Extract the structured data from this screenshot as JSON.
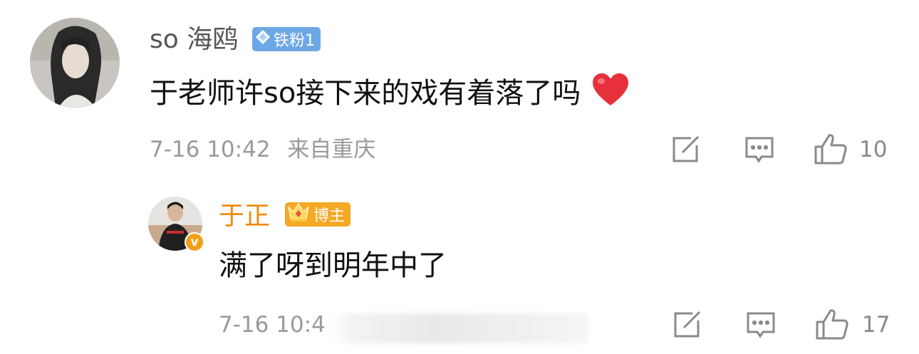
{
  "colors": {
    "username_gray": "#555555",
    "blogger_orange": "#f08a0c",
    "fan_badge_blue": "#6da8e6",
    "blogger_badge": "#f4a823",
    "meta_gray": "#9a9a9a",
    "heart_red": "#e8303c"
  },
  "comment": {
    "username": "so 海鸥",
    "badge": "铁粉1",
    "text": "于老师许so接下来的戏有着落了吗",
    "emoji": "heart-emoji",
    "time": "7-16 10:42",
    "location": "来自重庆",
    "like_count": "10"
  },
  "reply": {
    "username": "于正",
    "badge": "博主",
    "verified": "v",
    "text": "满了呀到明年中了",
    "time_visible": "7-16 10:4",
    "like_count": "17"
  }
}
